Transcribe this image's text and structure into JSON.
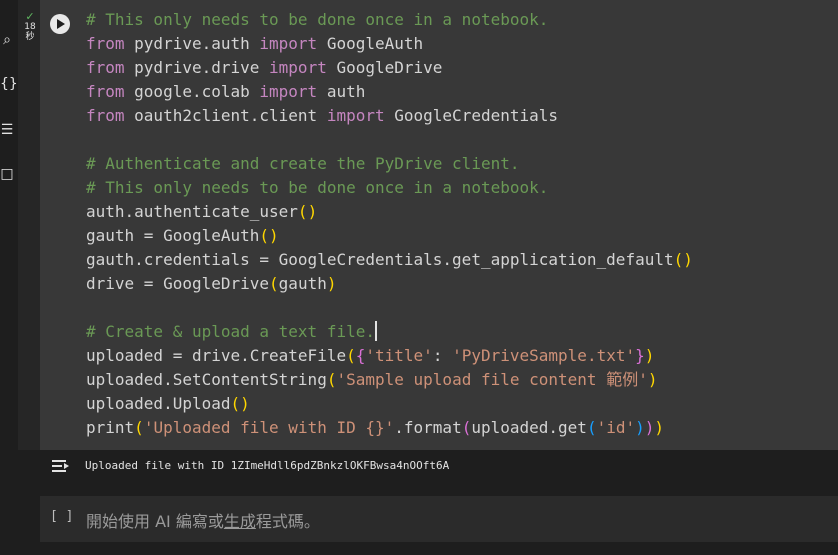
{
  "sidebar": {
    "icons": [
      "search-icon",
      "code-snippets-icon",
      "terminal-icon",
      "files-icon"
    ],
    "search_glyph": "⌕",
    "code_glyph": "{}",
    "terminal_glyph": "☰",
    "files_glyph": "□"
  },
  "cell": {
    "status_check": "✓",
    "status_duration_value": "18",
    "status_duration_unit": "秒",
    "code_lines": [
      "# This only needs to be done once in a notebook.",
      "from pydrive.auth import GoogleAuth",
      "from pydrive.drive import GoogleDrive",
      "from google.colab import auth",
      "from oauth2client.client import GoogleCredentials",
      "",
      "# Authenticate and create the PyDrive client.",
      "# This only needs to be done once in a notebook.",
      "auth.authenticate_user()",
      "gauth = GoogleAuth()",
      "gauth.credentials = GoogleCredentials.get_application_default()",
      "drive = GoogleDrive(gauth)",
      "",
      "# Create & upload a text file.",
      "uploaded = drive.CreateFile({'title': 'PyDriveSample.txt'})",
      "uploaded.SetContentString('Sample upload file content 範例')",
      "uploaded.Upload()",
      "print('Uploaded file with ID {}'.format(uploaded.get('id')))"
    ]
  },
  "output": {
    "text": "Uploaded file with ID 1ZImeHdll6pdZBnkzlOKFBwsa4nOOft6A"
  },
  "empty_cell": {
    "bracket": "[ ]",
    "placeholder_prefix": "開始使用 AI 編寫或",
    "placeholder_link": "生成",
    "placeholder_suffix": "程式碼。"
  },
  "colors": {
    "background": "#1e1e1e",
    "cell_background": "#383838",
    "comment": "#6a9955",
    "keyword": "#c586c0",
    "string": "#ce9178",
    "text": "#d4d4d4",
    "success": "#5fb760"
  }
}
